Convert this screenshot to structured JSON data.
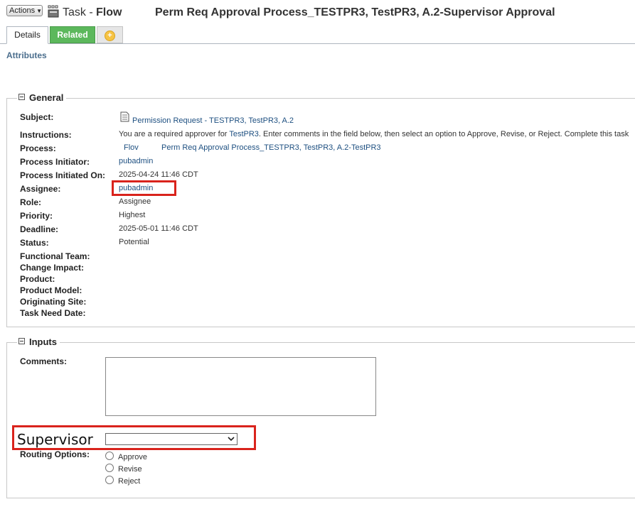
{
  "header": {
    "actions_label": "Actions",
    "task_label": "Task -",
    "flow_label": "Flow",
    "title": "Perm Req Approval Process_TESTPR3, TestPR3, A.2-Supervisor Approval"
  },
  "tabs": [
    {
      "label": "Details",
      "active": true
    },
    {
      "label": "Related",
      "active": false
    },
    {
      "label": "",
      "icon": "add-circle-icon"
    }
  ],
  "attributes_label": "Attributes",
  "general": {
    "legend": "General",
    "fields": {
      "subject": {
        "label": "Subject:",
        "value": "Permission Request - TESTPR3, TestPR3, A.2"
      },
      "instructions": {
        "label": "Instructions:",
        "prefix": "You are a required approver for ",
        "link": "TestPR3",
        "suffix": ". Enter comments in the field below, then select an option to Approve, Revise, or Reject. Complete this task"
      },
      "process": {
        "label": "Process:",
        "flow": "Flov",
        "value": "Perm Req Approval Process_TESTPR3, TestPR3, A.2-TestPR3"
      },
      "process_initiator": {
        "label": "Process Initiator:",
        "value": "pubadmin"
      },
      "process_initiated_on": {
        "label": "Process Initiated On:",
        "value": "2025-04-24 11:46 CDT"
      },
      "assignee": {
        "label": "Assignee:",
        "value": "pubadmin"
      },
      "role": {
        "label": "Role:",
        "value": "Assignee"
      },
      "priority": {
        "label": "Priority:",
        "value": "Highest"
      },
      "deadline": {
        "label": "Deadline:",
        "value": "2025-05-01 11:46 CDT"
      },
      "status": {
        "label": "Status:",
        "value": "Potential"
      },
      "functional_team": {
        "label": "Functional Team:",
        "value": ""
      },
      "change_impact": {
        "label": "Change Impact:",
        "value": ""
      },
      "product": {
        "label": "Product:",
        "value": ""
      },
      "product_model": {
        "label": "Product Model:",
        "value": ""
      },
      "originating_site": {
        "label": "Originating Site:",
        "value": ""
      },
      "task_need_date": {
        "label": "Task Need Date:",
        "value": ""
      }
    }
  },
  "inputs": {
    "legend": "Inputs",
    "comments_label": "Comments:",
    "comments_value": "",
    "supervisor_label": "Supervisor",
    "supervisor_selected": "",
    "routing_label": "Routing Options:",
    "routing_options": [
      "Approve",
      "Revise",
      "Reject"
    ]
  },
  "colors": {
    "related_tab": "#5cb85c",
    "highlight_box": "#d9231c",
    "link": "#1d4f80"
  }
}
